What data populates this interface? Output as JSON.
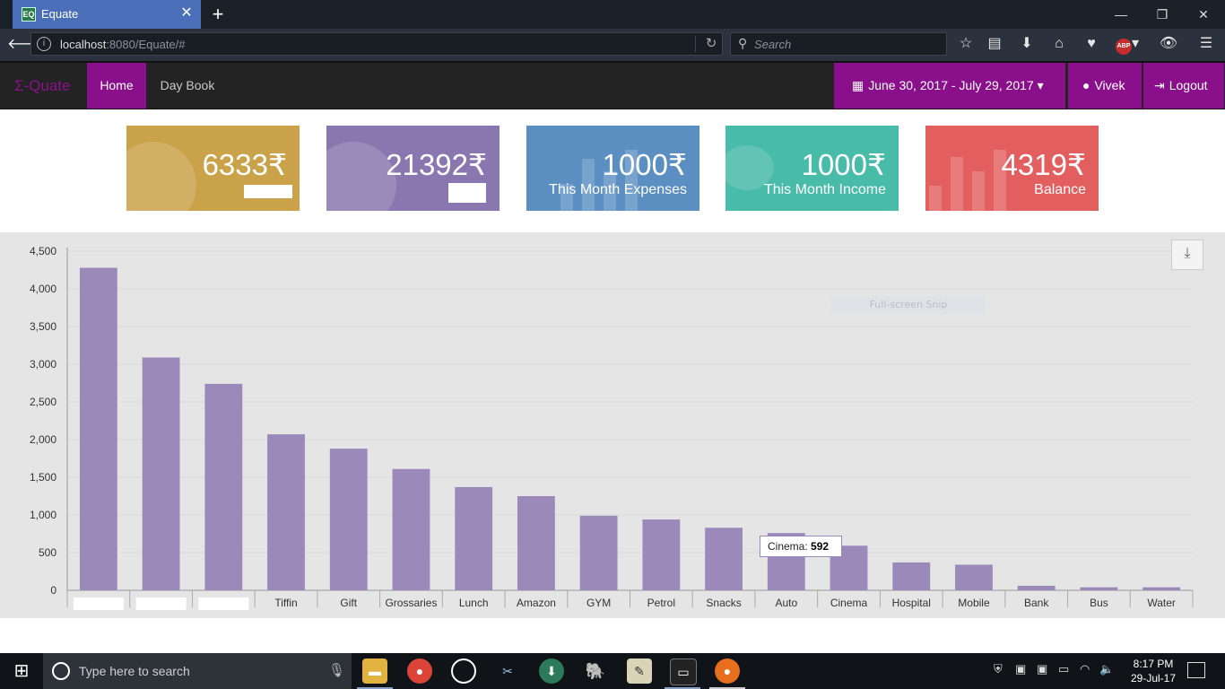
{
  "browser": {
    "tab_title": "Equate",
    "tab_favicon": "EQ",
    "close_glyph": "✕",
    "new_tab_glyph": "+",
    "window_controls": [
      "—",
      "❐",
      "✕"
    ],
    "url_host": "localhost",
    "url_rest": ":8080/Equate/#",
    "search_placeholder": "Search",
    "toolbar_icons": [
      "bookmark-star-icon",
      "reading-list-icon",
      "download-icon",
      "home-icon",
      "pocket-icon",
      "adblock-icon",
      "extension-icon",
      "menu-icon"
    ],
    "abp_label": "ABP"
  },
  "app": {
    "brand": "Σ-Quate",
    "nav": {
      "home": "Home",
      "daybook": "Day Book"
    },
    "daterange": "June 30, 2017 - July 29, 2017",
    "user": "Vivek",
    "logout": "Logout"
  },
  "cards": [
    {
      "value": "6333₹",
      "label": "",
      "color": "#c9a24a"
    },
    {
      "value": "21392₹",
      "label": "",
      "color": "#8a77b0"
    },
    {
      "value": "1000₹",
      "label": "This Month Expenses",
      "color": "#5b8fc2"
    },
    {
      "value": "1000₹",
      "label": "This Month Income",
      "color": "#48bba9"
    },
    {
      "value": "4319₹",
      "label": "Balance",
      "color": "#e35f5f"
    }
  ],
  "snip_label": "Full-screen Snip",
  "tooltip": {
    "label": "Cinema: ",
    "value": "592"
  },
  "chart_data": {
    "type": "bar",
    "categories": [
      "",
      "",
      "",
      "Tiffin",
      "Gift",
      "Grossaries",
      "Lunch",
      "Amazon",
      "GYM",
      "Petrol",
      "Snacks",
      "Auto",
      "Cinema",
      "Hospital",
      "Mobile",
      "Bank",
      "Bus",
      "Water"
    ],
    "values": [
      4280,
      3090,
      2740,
      2070,
      1880,
      1610,
      1370,
      1250,
      990,
      940,
      830,
      760,
      592,
      370,
      340,
      60,
      40,
      40
    ],
    "yticks": [
      0,
      500,
      1000,
      1500,
      2000,
      2500,
      3000,
      3500,
      4000,
      4500
    ],
    "ytick_labels": [
      "0",
      "500",
      "1,000",
      "1,500",
      "2,000",
      "2,500",
      "3,000",
      "3,500",
      "4,000",
      "4,500"
    ],
    "ylim": [
      0,
      4500
    ],
    "bar_color": "#9b8ab9",
    "grid": true
  },
  "taskbar": {
    "search_placeholder": "Type here to search",
    "apps": [
      "file-explorer-icon",
      "chrome-icon",
      "groove-icon",
      "snipping-icon",
      "app-icon",
      "postgres-icon",
      "notepad-icon",
      "cmd-icon",
      "firefox-icon"
    ],
    "time": "8:17 PM",
    "date": "29-Jul-17"
  }
}
